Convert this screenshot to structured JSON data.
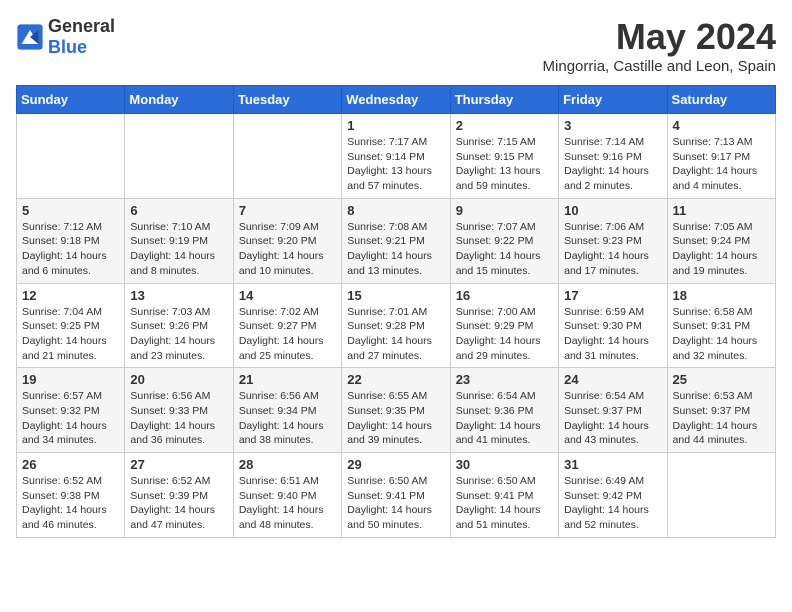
{
  "header": {
    "logo_general": "General",
    "logo_blue": "Blue",
    "month_title": "May 2024",
    "location": "Mingorria, Castille and Leon, Spain"
  },
  "weekdays": [
    "Sunday",
    "Monday",
    "Tuesday",
    "Wednesday",
    "Thursday",
    "Friday",
    "Saturday"
  ],
  "weeks": [
    [
      {
        "day": "",
        "info": ""
      },
      {
        "day": "",
        "info": ""
      },
      {
        "day": "",
        "info": ""
      },
      {
        "day": "1",
        "info": "Sunrise: 7:17 AM\nSunset: 9:14 PM\nDaylight: 13 hours and 57 minutes."
      },
      {
        "day": "2",
        "info": "Sunrise: 7:15 AM\nSunset: 9:15 PM\nDaylight: 13 hours and 59 minutes."
      },
      {
        "day": "3",
        "info": "Sunrise: 7:14 AM\nSunset: 9:16 PM\nDaylight: 14 hours and 2 minutes."
      },
      {
        "day": "4",
        "info": "Sunrise: 7:13 AM\nSunset: 9:17 PM\nDaylight: 14 hours and 4 minutes."
      }
    ],
    [
      {
        "day": "5",
        "info": "Sunrise: 7:12 AM\nSunset: 9:18 PM\nDaylight: 14 hours and 6 minutes."
      },
      {
        "day": "6",
        "info": "Sunrise: 7:10 AM\nSunset: 9:19 PM\nDaylight: 14 hours and 8 minutes."
      },
      {
        "day": "7",
        "info": "Sunrise: 7:09 AM\nSunset: 9:20 PM\nDaylight: 14 hours and 10 minutes."
      },
      {
        "day": "8",
        "info": "Sunrise: 7:08 AM\nSunset: 9:21 PM\nDaylight: 14 hours and 13 minutes."
      },
      {
        "day": "9",
        "info": "Sunrise: 7:07 AM\nSunset: 9:22 PM\nDaylight: 14 hours and 15 minutes."
      },
      {
        "day": "10",
        "info": "Sunrise: 7:06 AM\nSunset: 9:23 PM\nDaylight: 14 hours and 17 minutes."
      },
      {
        "day": "11",
        "info": "Sunrise: 7:05 AM\nSunset: 9:24 PM\nDaylight: 14 hours and 19 minutes."
      }
    ],
    [
      {
        "day": "12",
        "info": "Sunrise: 7:04 AM\nSunset: 9:25 PM\nDaylight: 14 hours and 21 minutes."
      },
      {
        "day": "13",
        "info": "Sunrise: 7:03 AM\nSunset: 9:26 PM\nDaylight: 14 hours and 23 minutes."
      },
      {
        "day": "14",
        "info": "Sunrise: 7:02 AM\nSunset: 9:27 PM\nDaylight: 14 hours and 25 minutes."
      },
      {
        "day": "15",
        "info": "Sunrise: 7:01 AM\nSunset: 9:28 PM\nDaylight: 14 hours and 27 minutes."
      },
      {
        "day": "16",
        "info": "Sunrise: 7:00 AM\nSunset: 9:29 PM\nDaylight: 14 hours and 29 minutes."
      },
      {
        "day": "17",
        "info": "Sunrise: 6:59 AM\nSunset: 9:30 PM\nDaylight: 14 hours and 31 minutes."
      },
      {
        "day": "18",
        "info": "Sunrise: 6:58 AM\nSunset: 9:31 PM\nDaylight: 14 hours and 32 minutes."
      }
    ],
    [
      {
        "day": "19",
        "info": "Sunrise: 6:57 AM\nSunset: 9:32 PM\nDaylight: 14 hours and 34 minutes."
      },
      {
        "day": "20",
        "info": "Sunrise: 6:56 AM\nSunset: 9:33 PM\nDaylight: 14 hours and 36 minutes."
      },
      {
        "day": "21",
        "info": "Sunrise: 6:56 AM\nSunset: 9:34 PM\nDaylight: 14 hours and 38 minutes."
      },
      {
        "day": "22",
        "info": "Sunrise: 6:55 AM\nSunset: 9:35 PM\nDaylight: 14 hours and 39 minutes."
      },
      {
        "day": "23",
        "info": "Sunrise: 6:54 AM\nSunset: 9:36 PM\nDaylight: 14 hours and 41 minutes."
      },
      {
        "day": "24",
        "info": "Sunrise: 6:54 AM\nSunset: 9:37 PM\nDaylight: 14 hours and 43 minutes."
      },
      {
        "day": "25",
        "info": "Sunrise: 6:53 AM\nSunset: 9:37 PM\nDaylight: 14 hours and 44 minutes."
      }
    ],
    [
      {
        "day": "26",
        "info": "Sunrise: 6:52 AM\nSunset: 9:38 PM\nDaylight: 14 hours and 46 minutes."
      },
      {
        "day": "27",
        "info": "Sunrise: 6:52 AM\nSunset: 9:39 PM\nDaylight: 14 hours and 47 minutes."
      },
      {
        "day": "28",
        "info": "Sunrise: 6:51 AM\nSunset: 9:40 PM\nDaylight: 14 hours and 48 minutes."
      },
      {
        "day": "29",
        "info": "Sunrise: 6:50 AM\nSunset: 9:41 PM\nDaylight: 14 hours and 50 minutes."
      },
      {
        "day": "30",
        "info": "Sunrise: 6:50 AM\nSunset: 9:41 PM\nDaylight: 14 hours and 51 minutes."
      },
      {
        "day": "31",
        "info": "Sunrise: 6:49 AM\nSunset: 9:42 PM\nDaylight: 14 hours and 52 minutes."
      },
      {
        "day": "",
        "info": ""
      }
    ]
  ]
}
